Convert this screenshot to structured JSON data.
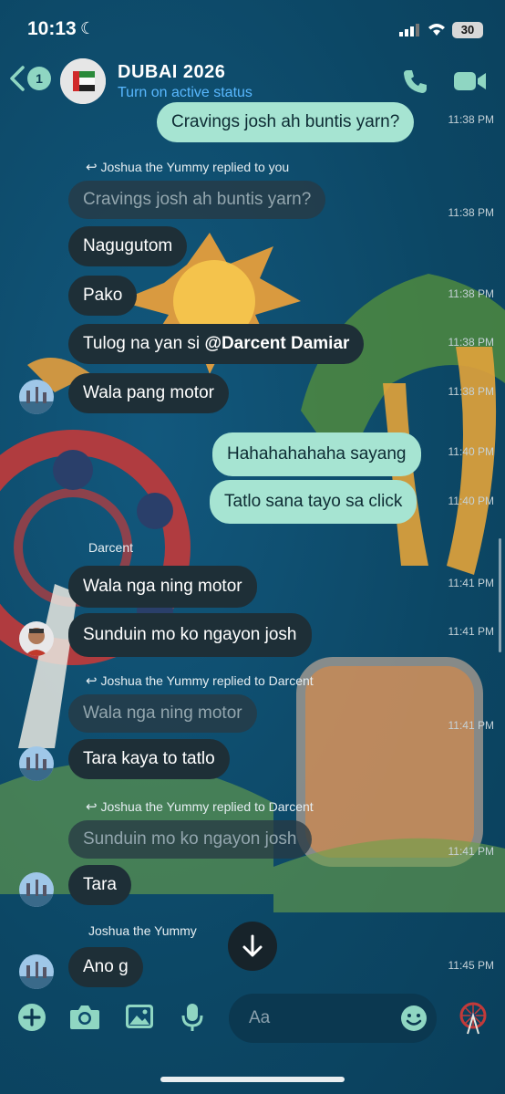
{
  "status_bar": {
    "time": "10:13",
    "battery": "30"
  },
  "header": {
    "back_count": "1",
    "title": "DUBAI 2026",
    "subtitle": "Turn on active status"
  },
  "messages": [
    {
      "dir": "out",
      "text": "Cravings josh ah buntis yarn?",
      "time": "11:38 PM"
    },
    {
      "reply_note": "Joshua the Yummy replied to you",
      "quote": "Cravings josh ah buntis yarn?",
      "time": "11:38 PM"
    },
    {
      "dir": "in",
      "text": "Nagugutom"
    },
    {
      "dir": "in",
      "text": "Pako",
      "time": "11:38 PM"
    },
    {
      "dir": "in",
      "text_prefix": "Tulog na yan si ",
      "mention": "@Darcent Damiar",
      "time": "11:38 PM"
    },
    {
      "dir": "in",
      "text": "Wala pang motor",
      "time": "11:38 PM"
    },
    {
      "dir": "out",
      "text": "Hahahahahaha sayang",
      "time": "11:40 PM"
    },
    {
      "dir": "out",
      "text": "Tatlo sana tayo sa click",
      "time": "11:40 PM"
    },
    {
      "sender": "Darcent",
      "dir": "in",
      "text": "Wala nga ning motor",
      "time": "11:41 PM"
    },
    {
      "dir": "in",
      "text": "Sunduin mo ko ngayon josh",
      "time": "11:41 PM"
    },
    {
      "reply_note": "Joshua the Yummy replied to Darcent",
      "quote": "Wala nga ning motor",
      "time": "11:41 PM"
    },
    {
      "dir": "in",
      "text": "Tara kaya to tatlo"
    },
    {
      "reply_note": "Joshua the Yummy replied to Darcent",
      "quote": "Sunduin mo ko ngayon josh",
      "time": "11:41 PM"
    },
    {
      "dir": "in",
      "text": "Tara"
    },
    {
      "sender": "Joshua the Yummy",
      "dir": "in",
      "text": "Ano g",
      "time": "11:45 PM"
    }
  ],
  "composer": {
    "placeholder": "Aa"
  },
  "colors": {
    "outgoing_bubble": "#a6e4d2",
    "incoming_bubble": "#1e2f37",
    "accent": "#8fd6c2",
    "link": "#59b8ff"
  },
  "icons": [
    "back-chevron-icon",
    "phone-icon",
    "video-icon",
    "plus-icon",
    "camera-icon",
    "gallery-icon",
    "microphone-icon",
    "emoji-icon",
    "ferris-wheel-sticker-icon",
    "reply-arrow-icon",
    "scroll-down-arrow-icon"
  ]
}
